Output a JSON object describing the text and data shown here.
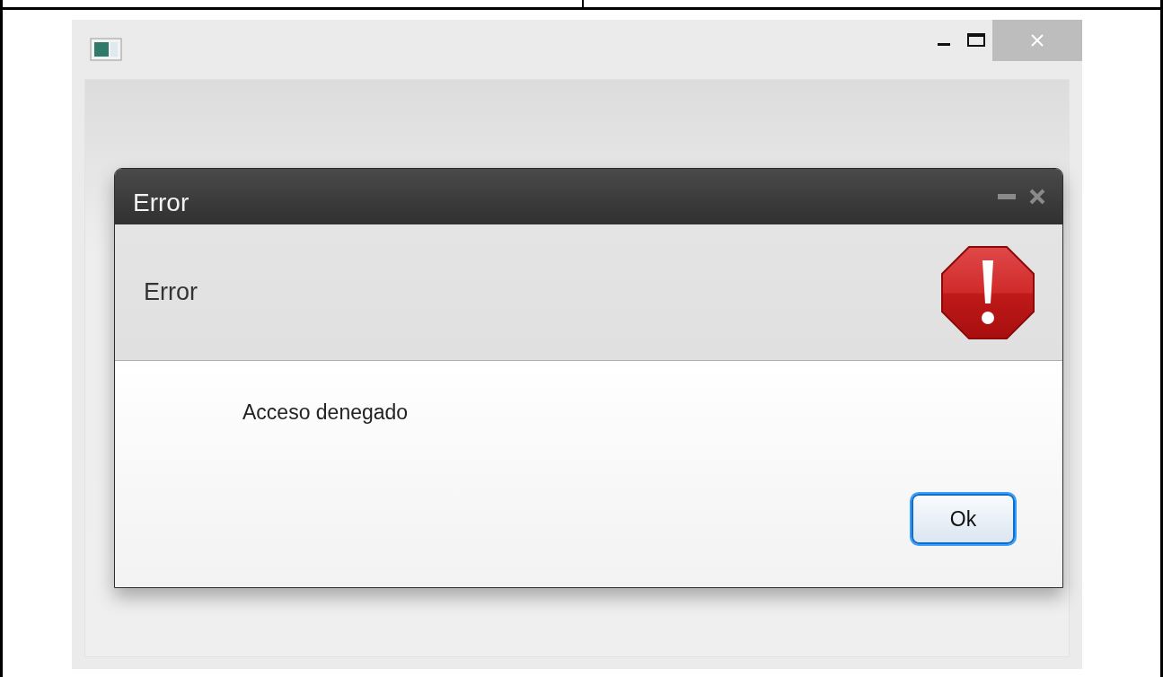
{
  "dialog": {
    "title": "Error",
    "header": "Error",
    "message": "Acceso denegado",
    "buttons": [
      {
        "label": "Ok",
        "selected": true
      }
    ]
  }
}
